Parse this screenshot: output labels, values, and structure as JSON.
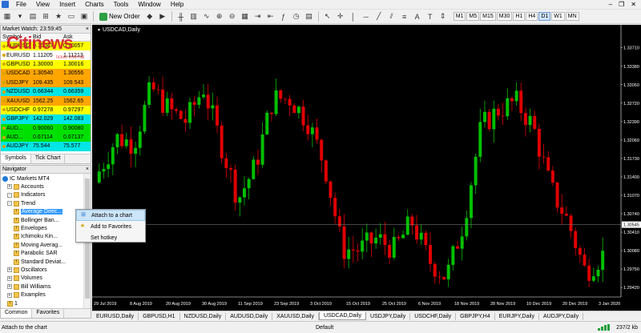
{
  "menu": [
    "File",
    "View",
    "Insert",
    "Charts",
    "Tools",
    "Window",
    "Help"
  ],
  "toolbar": {
    "new_order_label": "New Order",
    "timeframes": [
      "M1",
      "M5",
      "M15",
      "M30",
      "H1",
      "H4",
      "D1",
      "W1",
      "MN"
    ],
    "active_timeframe": "D1"
  },
  "market_watch": {
    "title": "Market Watch: 23:59:45",
    "columns": [
      "Symbol",
      "Bid",
      "Ask"
    ],
    "rows": [
      {
        "symbol": "AUDUSD",
        "bid": "0.70047",
        "ask": "0.70057",
        "color": "yellow"
      },
      {
        "symbol": "EURUSD",
        "bid": "1.11205",
        "ask": "1.11213",
        "color": "white"
      },
      {
        "symbol": "GBPUSD",
        "bid": "1.30000",
        "ask": "1.30016",
        "color": "yellow"
      },
      {
        "symbol": "USDCAD",
        "bid": "1.30540",
        "ask": "1.30556",
        "color": "orange"
      },
      {
        "symbol": "USDJPY",
        "bid": "109.435",
        "ask": "109.543",
        "color": "orange"
      },
      {
        "symbol": "NZDUSD",
        "bid": "0.66344",
        "ask": "0.66359",
        "color": "cyan"
      },
      {
        "symbol": "XAUUSD",
        "bid": "1562.25",
        "ask": "1562.65",
        "color": "orange"
      },
      {
        "symbol": "USDCHF",
        "bid": "0.97278",
        "ask": "0.97297",
        "color": "yellow"
      },
      {
        "symbol": "GBPJPY",
        "bid": "142.029",
        "ask": "142.083",
        "color": "cyan"
      },
      {
        "symbol": "AUD...",
        "bid": "0.90060",
        "ask": "0.90080",
        "color": "green"
      },
      {
        "symbol": "AUD...",
        "bid": "0.67114",
        "ask": "0.67137",
        "color": "green"
      },
      {
        "symbol": "AUDJPY",
        "bid": "75.544",
        "ask": "75.577",
        "color": "cyan"
      }
    ],
    "tabs": [
      "Symbols",
      "Tick Chart"
    ]
  },
  "navigator": {
    "title": "Navigator",
    "items": [
      {
        "label": "IC Markets MT4",
        "level": 0,
        "icon": "terminal-icon"
      },
      {
        "label": "Accounts",
        "level": 1,
        "icon": "folder-icon",
        "expander": "+"
      },
      {
        "label": "Indicators",
        "level": 1,
        "icon": "folder-icon",
        "expander": "-"
      },
      {
        "label": "Trend",
        "level": 2,
        "icon": "folder-icon",
        "expander": "-"
      },
      {
        "label": "Average Direc...",
        "level": 3,
        "icon": "indicator-icon",
        "selected": true
      },
      {
        "label": "Bollinger Ban...",
        "level": 3,
        "icon": "indicator-icon"
      },
      {
        "label": "Envelopes",
        "level": 3,
        "icon": "indicator-icon"
      },
      {
        "label": "Ichimoku Kin...",
        "level": 3,
        "icon": "indicator-icon"
      },
      {
        "label": "Moving Averag...",
        "level": 3,
        "icon": "indicator-icon"
      },
      {
        "label": "Parabolic SAR",
        "level": 3,
        "icon": "indicator-icon"
      },
      {
        "label": "Standard Deviat...",
        "level": 3,
        "icon": "indicator-icon"
      },
      {
        "label": "Oscillators",
        "level": 2,
        "icon": "folder-icon",
        "expander": "+"
      },
      {
        "label": "Volumes",
        "level": 2,
        "icon": "folder-icon",
        "expander": "+"
      },
      {
        "label": "Bill Williams",
        "level": 2,
        "icon": "folder-icon",
        "expander": "+"
      },
      {
        "label": "Examples",
        "level": 2,
        "icon": "folder-icon",
        "expander": "+"
      },
      {
        "label": "1",
        "level": 2,
        "icon": "indicator-icon"
      }
    ],
    "tabs": [
      "Common",
      "Favorites"
    ]
  },
  "context_menu": {
    "items": [
      {
        "label": "Attach to a chart",
        "icon": "attach-icon",
        "highlighted": true
      },
      {
        "label": "Add to Favorites",
        "icon": "star-icon"
      },
      {
        "label": "Set hotkey",
        "icon": "key-icon"
      }
    ]
  },
  "watermark": {
    "logo": "Citinews",
    "sub": "ticket internal"
  },
  "chart": {
    "title": "USDCAD,Daily",
    "current_price": "1.30545",
    "price_labels": [
      "1.33710",
      "1.33380",
      "1.33050",
      "1.32720",
      "1.32390",
      "1.32060",
      "1.31730",
      "1.31400",
      "1.31070",
      "1.30740",
      "1.30410",
      "1.30080",
      "1.29750",
      "1.29420"
    ],
    "date_labels": [
      "29 Jul 2019",
      "8 Aug 2019",
      "20 Aug 2019",
      "30 Aug 2019",
      "11 Sep 2019",
      "23 Sep 2019",
      "3 Oct 2019",
      "15 Oct 2019",
      "25 Oct 2019",
      "6 Nov 2019",
      "18 Nov 2019",
      "28 Nov 2019",
      "10 Dec 2019",
      "20 Dec 2019",
      "3 Jan 2020"
    ],
    "colors": {
      "bull": "#00c000",
      "bear": "#e00000",
      "background": "#000000",
      "text": "#ffffff"
    }
  },
  "chart_data": {
    "type": "candlestick",
    "title": "USDCAD,Daily",
    "ylim": [
      1.2925,
      1.3395
    ],
    "x": [
      "29 Jul 2019",
      "8 Aug 2019",
      "20 Aug 2019",
      "30 Aug 2019",
      "11 Sep 2019",
      "23 Sep 2019",
      "3 Oct 2019",
      "15 Oct 2019",
      "25 Oct 2019",
      "6 Nov 2019",
      "18 Nov 2019",
      "28 Nov 2019",
      "10 Dec 2019",
      "20 Dec 2019",
      "3 Jan 2020"
    ],
    "series": [
      {
        "name": "USDCAD",
        "close": [
          1.315,
          1.321,
          1.32,
          1.33,
          1.326,
          1.324,
          1.33,
          1.32,
          1.31,
          1.316,
          1.328,
          1.328,
          1.324,
          1.316,
          1.301,
          1.301,
          1.303,
          1.301,
          1.306,
          1.299,
          1.296,
          1.306,
          1.323,
          1.326,
          1.3275,
          1.323,
          1.312,
          1.306,
          1.297,
          1.3
        ]
      }
    ]
  },
  "chart_tabs": [
    "EURUSD,Daily",
    "GBPUSD,H1",
    "NZDUSD,Daily",
    "AUDUSD,Daily",
    "XAUUSD,Daily",
    "USDCAD,Daily",
    "USDJPY,Daily",
    "USDCHF,Daily",
    "GBPJPY,H4",
    "EURJPY,Daily",
    "AUDJPY,Daily"
  ],
  "active_chart_tab": "USDCAD,Daily",
  "status": {
    "left": "Attach to the chart",
    "mid": "Default",
    "traffic": "237/2 kb"
  }
}
